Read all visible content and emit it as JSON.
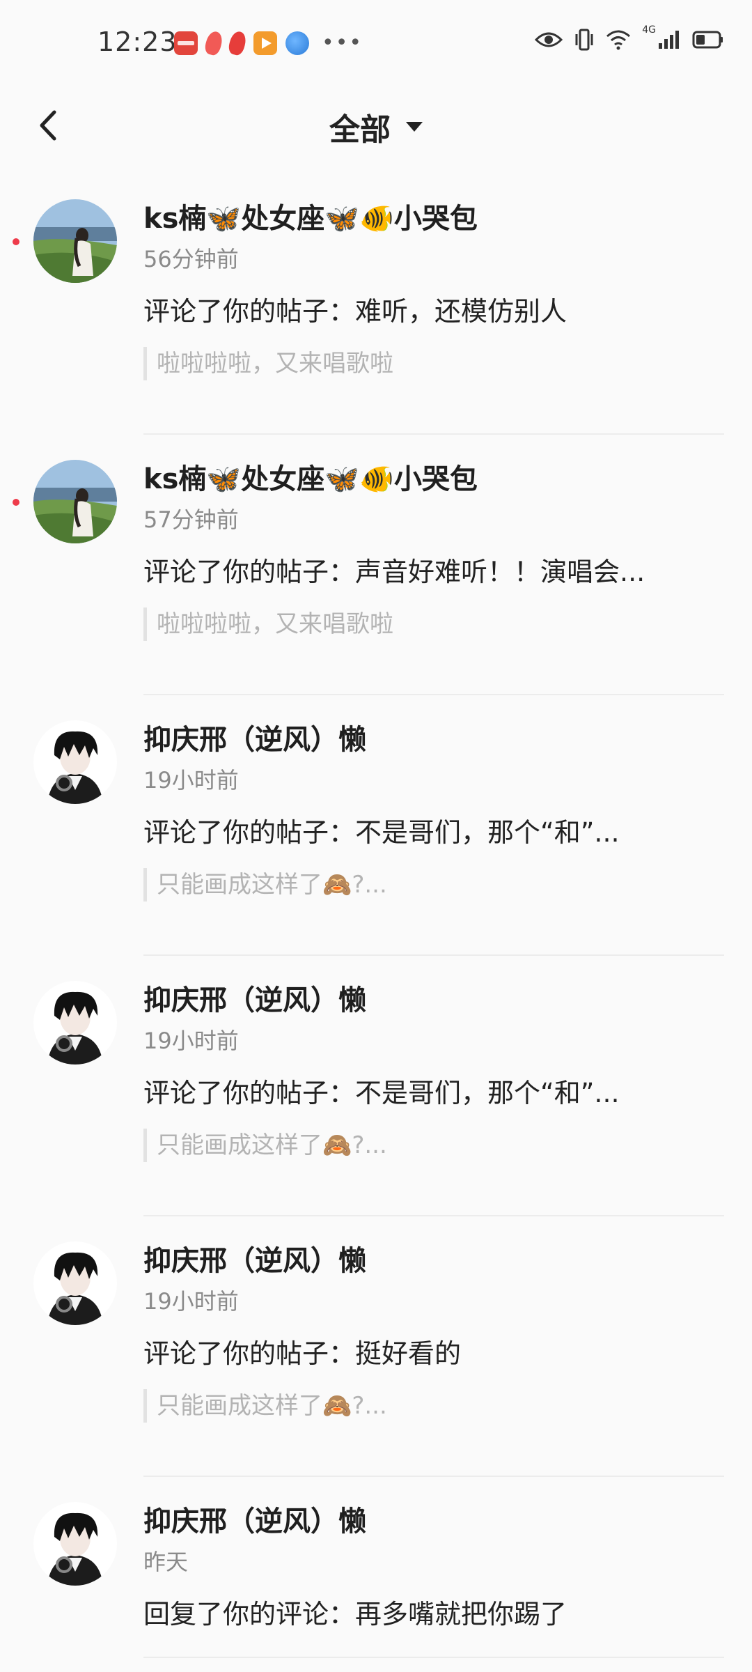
{
  "status_bar": {
    "time": "12:23",
    "more": "•••",
    "network": "4G"
  },
  "header": {
    "title": "全部"
  },
  "notifications": [
    {
      "username": "ks楠🦋处女座🦋🐠小哭包",
      "time": "56分钟前",
      "comment": "评论了你的帖子：难听，还模仿别人",
      "quote": "啦啦啦啦，又来唱歌啦"
    },
    {
      "username": "ks楠🦋处女座🦋🐠小哭包",
      "time": "57分钟前",
      "comment": "评论了你的帖子：声音好难听！！演唱会...",
      "quote": "啦啦啦啦，又来唱歌啦"
    },
    {
      "username": "抑庆邢（逆风）懒",
      "time": "19小时前",
      "comment": "评论了你的帖子：不是哥们，那个“和”...",
      "quote": "只能画成这样了🙈?..."
    },
    {
      "username": "抑庆邢（逆风）懒",
      "time": "19小时前",
      "comment": "评论了你的帖子：不是哥们，那个“和”...",
      "quote": "只能画成这样了🙈?..."
    },
    {
      "username": "抑庆邢（逆风）懒",
      "time": "19小时前",
      "comment": "评论了你的帖子：挺好看的",
      "quote": "只能画成这样了🙈?..."
    },
    {
      "username": "抑庆邢（逆风）懒",
      "time": "昨天",
      "comment": "回复了你的评论：再多嘴就把你踢了"
    }
  ],
  "colors": {
    "unread_dot": "#ee3b4a",
    "text_primary": "#222222",
    "text_secondary": "#8a8a8a",
    "quote_text": "#b3b3b3"
  }
}
